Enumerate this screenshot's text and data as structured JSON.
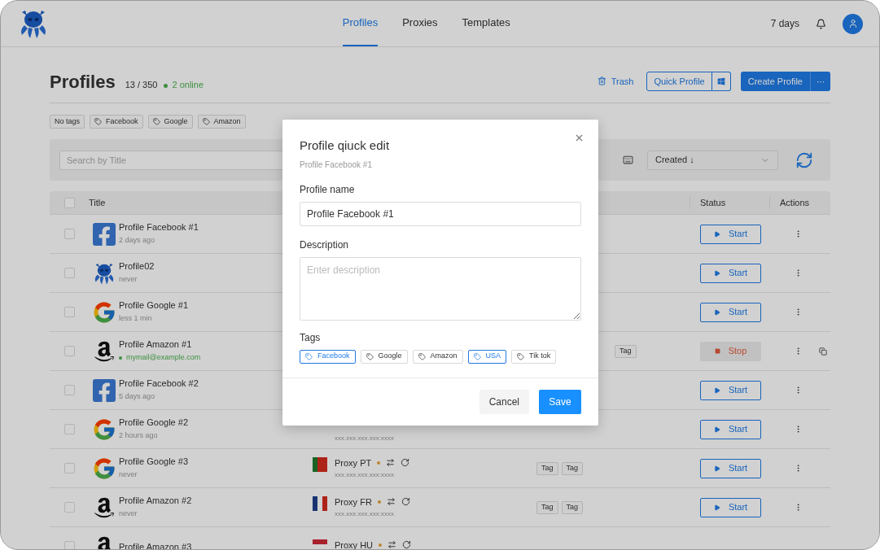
{
  "nav": {
    "tabs": [
      {
        "label": "Profiles",
        "selected": true
      },
      {
        "label": "Proxies",
        "selected": false
      },
      {
        "label": "Templates",
        "selected": false
      }
    ],
    "plan": "7 days"
  },
  "header": {
    "title": "Profiles",
    "count": "13 / 350",
    "online": "2 online",
    "trash": "Trash",
    "quick_profile": "Quick Profile",
    "create_profile": "Create Profile",
    "more": "···"
  },
  "filter_tags": [
    {
      "label": "No tags",
      "kind": "plain"
    },
    {
      "label": "Facebook",
      "kind": "tag"
    },
    {
      "label": "Google",
      "kind": "tag"
    },
    {
      "label": "Amazon",
      "kind": "tag"
    }
  ],
  "search": {
    "placeholder": "Search by Title"
  },
  "sort": {
    "value": "Created ↓"
  },
  "table": {
    "columns": [
      "Title",
      "Status",
      "Actions"
    ],
    "all_checked": false,
    "rows": [
      {
        "kind": "facebook",
        "title": "Profile Facebook #1",
        "subtitle": "2 days ago",
        "online": false,
        "tags": [],
        "status": {
          "kind": "start",
          "label": "Start"
        },
        "checked": false
      },
      {
        "kind": "octopus",
        "title": "Profile02",
        "subtitle": "never",
        "online": false,
        "tags": [],
        "status": {
          "kind": "start",
          "label": "Start"
        },
        "checked": false
      },
      {
        "kind": "google",
        "title": "Profile Google #1",
        "subtitle": "less 1 min",
        "online": false,
        "tags": [],
        "status": {
          "kind": "start",
          "label": "Start"
        },
        "checked": false
      },
      {
        "kind": "amazon",
        "title": "Profile Amazon #1",
        "subtitle": "mymail@example.com",
        "online": true,
        "tags": [
          "Tag"
        ],
        "status": {
          "kind": "stop",
          "label": "Stop"
        },
        "checked": false,
        "copy": true
      },
      {
        "kind": "facebook",
        "title": "Profile Facebook #2",
        "subtitle": "5 days ago",
        "online": false,
        "tags": [],
        "status": {
          "kind": "start",
          "label": "Start"
        },
        "checked": false
      },
      {
        "kind": "google",
        "title": "Profile Google #2",
        "subtitle": "2 hours ago",
        "online": false,
        "proxy": {
          "address": "xxx.xxx.xxx.xxx:xxxx"
        },
        "tags": [],
        "status": {
          "kind": "start",
          "label": "Start"
        },
        "checked": false
      },
      {
        "kind": "google",
        "title": "Profile Google #3",
        "subtitle": "never",
        "online": false,
        "proxy": {
          "kind": "pt",
          "name": "Proxy PT",
          "address": "xxx.xxx.xxx.xxx:xxxx"
        },
        "tags": [
          "Tag",
          "Tag"
        ],
        "status": {
          "kind": "start",
          "label": "Start"
        },
        "checked": false
      },
      {
        "kind": "amazon",
        "title": "Profile Amazon #2",
        "subtitle": "never",
        "online": false,
        "proxy": {
          "kind": "fr",
          "name": "Proxy FR",
          "address": "xxx.xxx.xxx.xxx:xxxx"
        },
        "tags": [
          "Tag",
          "Tag"
        ],
        "status": {
          "kind": "start",
          "label": "Start"
        },
        "checked": false
      },
      {
        "kind": "amazon",
        "title": "Profile Amazon #3",
        "proxy": {
          "kind": "hu",
          "name": "Proxy HU"
        },
        "tags": [],
        "checked": false
      }
    ]
  },
  "modal": {
    "title": "Profile qiuck edit",
    "subtitle": "Profile Facebook #1",
    "name_label": "Profile name",
    "name_value": "Profile Facebook #1",
    "description_label": "Description",
    "description_placeholder": "Enter description",
    "tags_label": "Tags",
    "tags": [
      {
        "label": "Facebook",
        "selected": true
      },
      {
        "label": "Google",
        "selected": false
      },
      {
        "label": "Amazon",
        "selected": false
      },
      {
        "label": "USA",
        "selected": true
      },
      {
        "label": "Tik tok",
        "selected": false
      }
    ],
    "cancel": "Cancel",
    "save": "Save"
  }
}
